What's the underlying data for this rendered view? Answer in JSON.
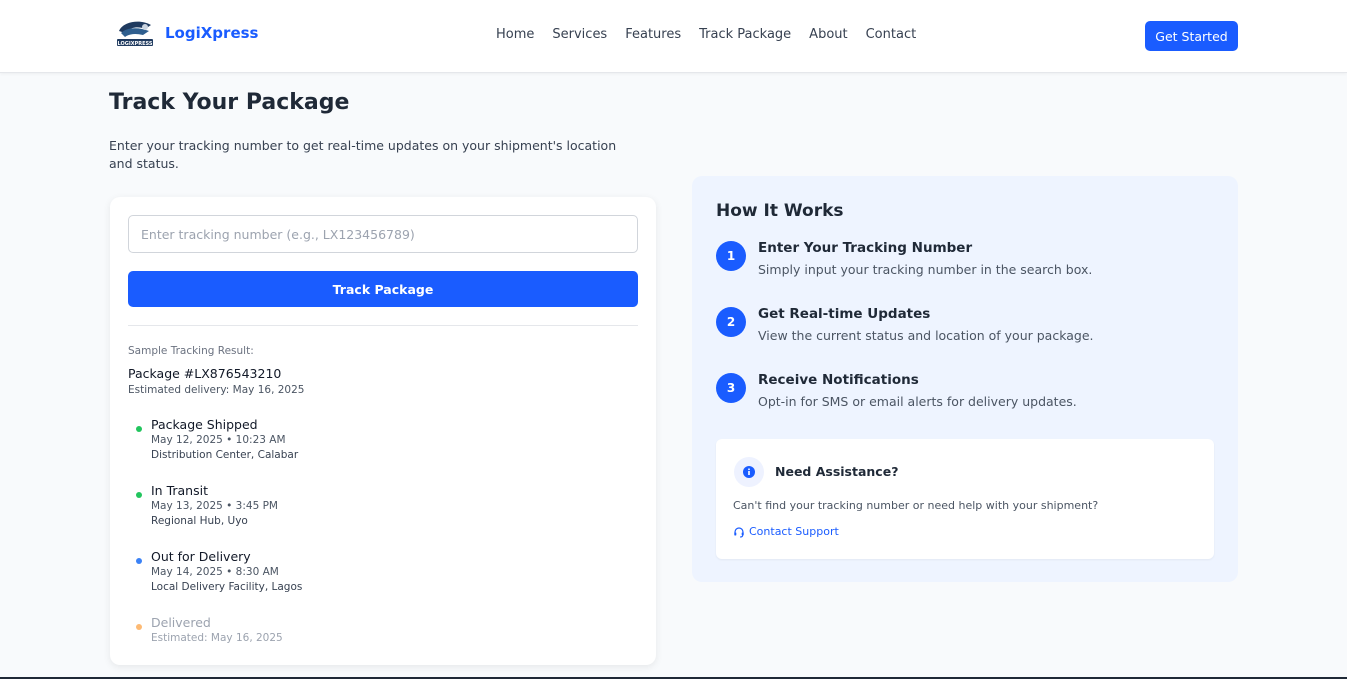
{
  "brand": {
    "name": "LogiXpress",
    "logo_text": "LOGIXPRESS"
  },
  "nav": {
    "items": [
      "Home",
      "Services",
      "Features",
      "Track Package",
      "About",
      "Contact"
    ],
    "cta": "Get Started"
  },
  "page": {
    "title": "Track Your Package",
    "subtitle": "Enter your tracking number to get real-time updates on your shipment's location and status."
  },
  "tracker": {
    "placeholder": "Enter tracking number (e.g., LX123456789)",
    "button": "Track Package",
    "sample_label": "Sample Tracking Result:",
    "package_id": "Package #LX876543210",
    "estimated": "Estimated delivery: May 16, 2025",
    "events": [
      {
        "title": "Package Shipped",
        "time": "May 12, 2025 • 10:23 AM",
        "location": "Distribution Center, Calabar",
        "status_color": "#22c55e"
      },
      {
        "title": "In Transit",
        "time": "May 13, 2025 • 3:45 PM",
        "location": "Regional Hub, Uyo",
        "status_color": "#22c55e"
      },
      {
        "title": "Out for Delivery",
        "time": "May 14, 2025 • 8:30 AM",
        "location": "Local Delivery Facility, Lagos",
        "status_color": "#3b82f6"
      },
      {
        "title": "Delivered",
        "time": "Estimated: May 16, 2025",
        "location": "",
        "status_color": "#fdba74"
      }
    ]
  },
  "how": {
    "title": "How It Works",
    "steps": [
      {
        "num": "1",
        "title": "Enter Your Tracking Number",
        "desc": "Simply input your tracking number in the search box."
      },
      {
        "num": "2",
        "title": "Get Real-time Updates",
        "desc": "View the current status and location of your package."
      },
      {
        "num": "3",
        "title": "Receive Notifications",
        "desc": "Opt-in for SMS or email alerts for delivery updates."
      }
    ],
    "assist": {
      "title": "Need Assistance?",
      "desc": "Can't find your tracking number or need help with your shipment?",
      "link": "Contact Support"
    }
  },
  "colors": {
    "accent": "#1a5cff",
    "panel": "#eef4ff",
    "background": "#f8fafc"
  }
}
